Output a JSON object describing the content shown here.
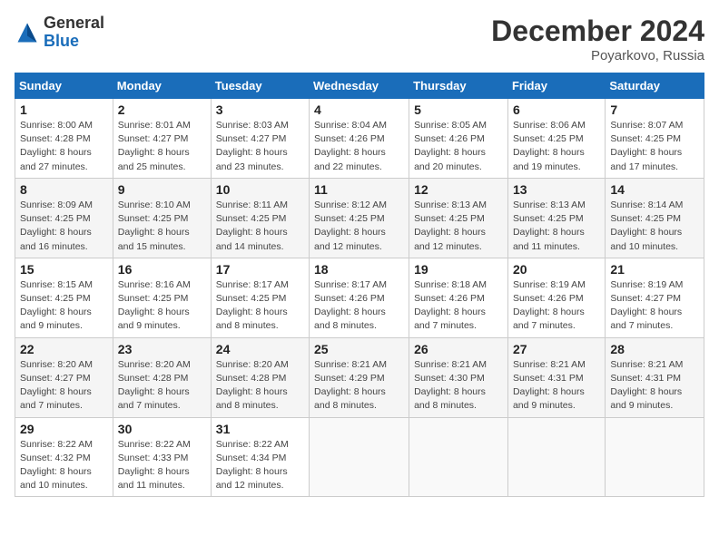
{
  "header": {
    "logo_general": "General",
    "logo_blue": "Blue",
    "month_title": "December 2024",
    "subtitle": "Poyarkovo, Russia"
  },
  "days_of_week": [
    "Sunday",
    "Monday",
    "Tuesday",
    "Wednesday",
    "Thursday",
    "Friday",
    "Saturday"
  ],
  "weeks": [
    [
      {
        "num": "1",
        "info": "Sunrise: 8:00 AM\nSunset: 4:28 PM\nDaylight: 8 hours\nand 27 minutes."
      },
      {
        "num": "2",
        "info": "Sunrise: 8:01 AM\nSunset: 4:27 PM\nDaylight: 8 hours\nand 25 minutes."
      },
      {
        "num": "3",
        "info": "Sunrise: 8:03 AM\nSunset: 4:27 PM\nDaylight: 8 hours\nand 23 minutes."
      },
      {
        "num": "4",
        "info": "Sunrise: 8:04 AM\nSunset: 4:26 PM\nDaylight: 8 hours\nand 22 minutes."
      },
      {
        "num": "5",
        "info": "Sunrise: 8:05 AM\nSunset: 4:26 PM\nDaylight: 8 hours\nand 20 minutes."
      },
      {
        "num": "6",
        "info": "Sunrise: 8:06 AM\nSunset: 4:25 PM\nDaylight: 8 hours\nand 19 minutes."
      },
      {
        "num": "7",
        "info": "Sunrise: 8:07 AM\nSunset: 4:25 PM\nDaylight: 8 hours\nand 17 minutes."
      }
    ],
    [
      {
        "num": "8",
        "info": "Sunrise: 8:09 AM\nSunset: 4:25 PM\nDaylight: 8 hours\nand 16 minutes."
      },
      {
        "num": "9",
        "info": "Sunrise: 8:10 AM\nSunset: 4:25 PM\nDaylight: 8 hours\nand 15 minutes."
      },
      {
        "num": "10",
        "info": "Sunrise: 8:11 AM\nSunset: 4:25 PM\nDaylight: 8 hours\nand 14 minutes."
      },
      {
        "num": "11",
        "info": "Sunrise: 8:12 AM\nSunset: 4:25 PM\nDaylight: 8 hours\nand 12 minutes."
      },
      {
        "num": "12",
        "info": "Sunrise: 8:13 AM\nSunset: 4:25 PM\nDaylight: 8 hours\nand 12 minutes."
      },
      {
        "num": "13",
        "info": "Sunrise: 8:13 AM\nSunset: 4:25 PM\nDaylight: 8 hours\nand 11 minutes."
      },
      {
        "num": "14",
        "info": "Sunrise: 8:14 AM\nSunset: 4:25 PM\nDaylight: 8 hours\nand 10 minutes."
      }
    ],
    [
      {
        "num": "15",
        "info": "Sunrise: 8:15 AM\nSunset: 4:25 PM\nDaylight: 8 hours\nand 9 minutes."
      },
      {
        "num": "16",
        "info": "Sunrise: 8:16 AM\nSunset: 4:25 PM\nDaylight: 8 hours\nand 9 minutes."
      },
      {
        "num": "17",
        "info": "Sunrise: 8:17 AM\nSunset: 4:25 PM\nDaylight: 8 hours\nand 8 minutes."
      },
      {
        "num": "18",
        "info": "Sunrise: 8:17 AM\nSunset: 4:26 PM\nDaylight: 8 hours\nand 8 minutes."
      },
      {
        "num": "19",
        "info": "Sunrise: 8:18 AM\nSunset: 4:26 PM\nDaylight: 8 hours\nand 7 minutes."
      },
      {
        "num": "20",
        "info": "Sunrise: 8:19 AM\nSunset: 4:26 PM\nDaylight: 8 hours\nand 7 minutes."
      },
      {
        "num": "21",
        "info": "Sunrise: 8:19 AM\nSunset: 4:27 PM\nDaylight: 8 hours\nand 7 minutes."
      }
    ],
    [
      {
        "num": "22",
        "info": "Sunrise: 8:20 AM\nSunset: 4:27 PM\nDaylight: 8 hours\nand 7 minutes."
      },
      {
        "num": "23",
        "info": "Sunrise: 8:20 AM\nSunset: 4:28 PM\nDaylight: 8 hours\nand 7 minutes."
      },
      {
        "num": "24",
        "info": "Sunrise: 8:20 AM\nSunset: 4:28 PM\nDaylight: 8 hours\nand 8 minutes."
      },
      {
        "num": "25",
        "info": "Sunrise: 8:21 AM\nSunset: 4:29 PM\nDaylight: 8 hours\nand 8 minutes."
      },
      {
        "num": "26",
        "info": "Sunrise: 8:21 AM\nSunset: 4:30 PM\nDaylight: 8 hours\nand 8 minutes."
      },
      {
        "num": "27",
        "info": "Sunrise: 8:21 AM\nSunset: 4:31 PM\nDaylight: 8 hours\nand 9 minutes."
      },
      {
        "num": "28",
        "info": "Sunrise: 8:21 AM\nSunset: 4:31 PM\nDaylight: 8 hours\nand 9 minutes."
      }
    ],
    [
      {
        "num": "29",
        "info": "Sunrise: 8:22 AM\nSunset: 4:32 PM\nDaylight: 8 hours\nand 10 minutes."
      },
      {
        "num": "30",
        "info": "Sunrise: 8:22 AM\nSunset: 4:33 PM\nDaylight: 8 hours\nand 11 minutes."
      },
      {
        "num": "31",
        "info": "Sunrise: 8:22 AM\nSunset: 4:34 PM\nDaylight: 8 hours\nand 12 minutes."
      },
      {
        "num": "",
        "info": ""
      },
      {
        "num": "",
        "info": ""
      },
      {
        "num": "",
        "info": ""
      },
      {
        "num": "",
        "info": ""
      }
    ]
  ]
}
